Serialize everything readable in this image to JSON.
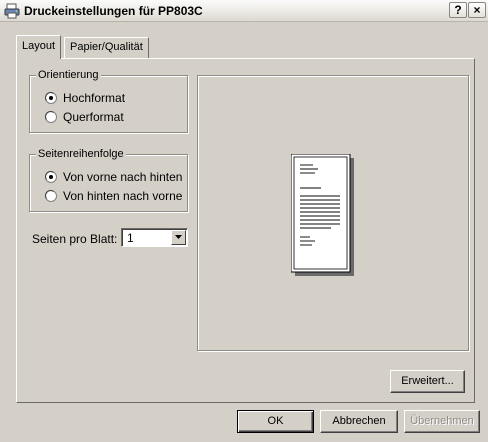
{
  "window": {
    "title": "Druckeinstellungen für PP803C",
    "help_label": "?",
    "close_label": "×"
  },
  "tabs": [
    {
      "label": "Layout",
      "active": true
    },
    {
      "label": "Papier/Qualität",
      "active": false
    }
  ],
  "orientation": {
    "legend": "Orientierung",
    "options": [
      "Hochformat",
      "Querformat"
    ],
    "selected": "Hochformat"
  },
  "page_order": {
    "legend": "Seitenreihenfolge",
    "options": [
      "Von vorne nach hinten",
      "Von hinten nach vorne"
    ],
    "selected": "Von vorne nach hinten"
  },
  "pages_per_sheet": {
    "label": "Seiten pro Blatt:",
    "value": "1"
  },
  "buttons": {
    "advanced": "Erweitert...",
    "ok": "OK",
    "cancel": "Abbrechen",
    "apply": "Übernehmen"
  },
  "colors": {
    "dialog_bg": "#d4d0c8",
    "title_icon": "#3a6fb8"
  }
}
